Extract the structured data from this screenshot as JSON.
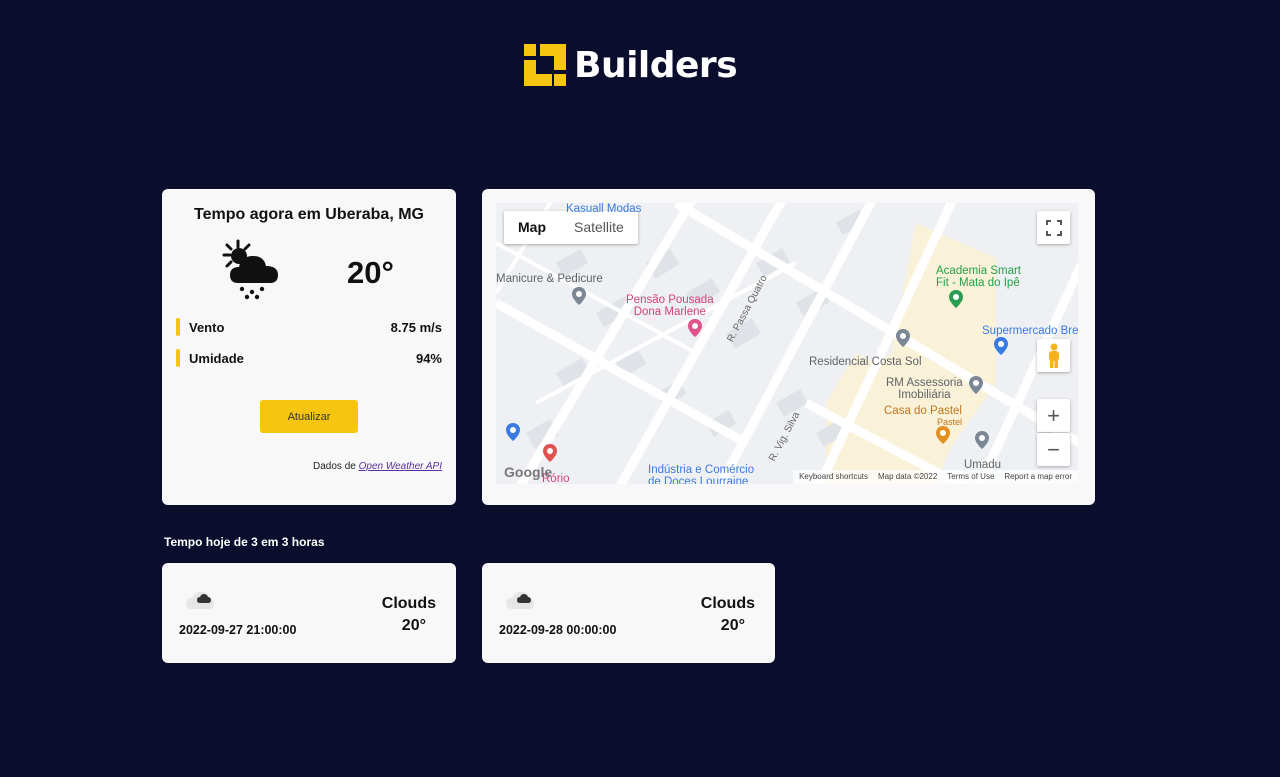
{
  "brand": {
    "name": "Builders",
    "accent": "#f6c50f",
    "background": "#0a0d2c"
  },
  "current": {
    "title": "Tempo agora em Uberaba, MG",
    "icon": "cloud-sun-rain-icon",
    "temperature": "20°",
    "stats": [
      {
        "label": "Vento",
        "value": "8.75 m/s"
      },
      {
        "label": "Umidade",
        "value": "94%"
      }
    ],
    "update_label": "Atualizar",
    "credit_prefix": "Dados de",
    "credit_link": "Open Weather API"
  },
  "map": {
    "type_buttons": [
      "Map",
      "Satellite"
    ],
    "active_type": "Map",
    "labels": {
      "kasuall": "Kasuall Modas",
      "manicure": "Manicure & Pedicure",
      "pousada": "Pensão Pousada\nDona Marlene",
      "passa_quatro": "R. Passa Quatro",
      "academia": "Academia Smart\nFit - Mata do Ipê",
      "supermercado": "Supermercado Bre",
      "residencial": "Residencial Costa Sol",
      "rm": "RM Assessoria\nImobiliária",
      "pastel": "Casa do Pastel",
      "pastel_sub": "Pastel",
      "vig_silva": "R. Vig. Silva",
      "industria": "Indústria e Comércio\nde Doces Lourraine",
      "umadu": "Umadu",
      "rorio": "Rório"
    },
    "google": "Google",
    "footer": [
      "Keyboard shortcuts",
      "Map data ©2022",
      "Terms of Use",
      "Report a map error"
    ]
  },
  "forecast": {
    "title": "Tempo hoje de 3 em 3 horas",
    "items": [
      {
        "date": "2022-09-27 21:00:00",
        "description": "Clouds",
        "temperature": "20°",
        "icon": "cloud-icon"
      },
      {
        "date": "2022-09-28 00:00:00",
        "description": "Clouds",
        "temperature": "20°",
        "icon": "cloud-icon"
      }
    ]
  }
}
